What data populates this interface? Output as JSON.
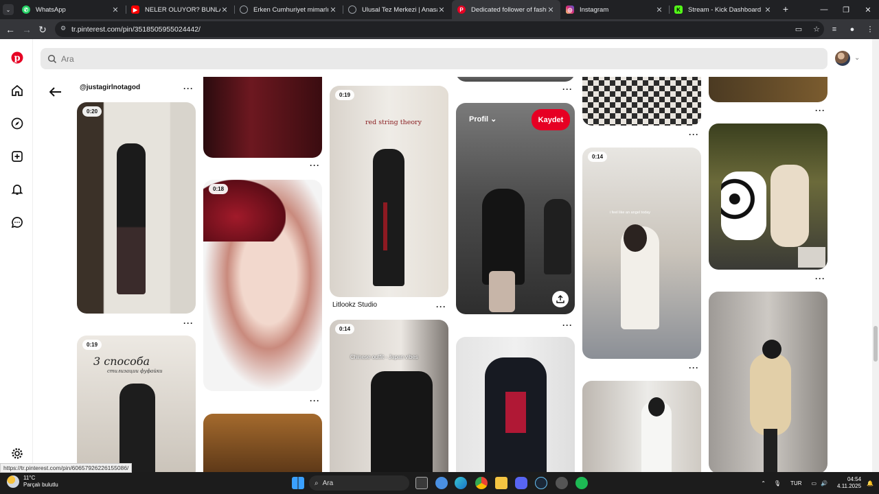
{
  "browser": {
    "tabs": [
      {
        "title": "WhatsApp",
        "icon": "whatsapp-icon",
        "color": "#25d366",
        "active": false
      },
      {
        "title": "NELER OLUYOR? BUNLAR KİM!",
        "icon": "youtube-icon",
        "color": "#ff0000",
        "active": false
      },
      {
        "title": "Erken Cumhuriyet mimarlığı",
        "icon": "web-icon",
        "color": "#9aa0a6",
        "active": false
      },
      {
        "title": "Ulusal Tez Merkezi | Anasayfa",
        "icon": "web-icon",
        "color": "#9aa0a6",
        "active": false
      },
      {
        "title": "Dedicated follower of fashion p",
        "icon": "pinterest-icon",
        "color": "#e60023",
        "active": true
      },
      {
        "title": "Instagram",
        "icon": "instagram-icon",
        "color": "#d62976",
        "active": false
      },
      {
        "title": "Stream - Kick Dashboard",
        "icon": "kick-icon",
        "color": "#53fc18",
        "active": false
      }
    ],
    "url": "tr.pinterest.com/pin/3518505955024442/"
  },
  "search": {
    "placeholder": "Ara"
  },
  "pins": {
    "col1_top_caption": "@justagirlnotagod",
    "col1_a_duration": "0:20",
    "col1_b_duration": "0:19",
    "col1_b_text": "3 способа",
    "col1_b_subtext": "стилизации фуфайки",
    "col2_b_duration": "0:18",
    "col3_a_duration": "0:19",
    "col3_a_text": "red string theory",
    "col3_a_caption": "Litlookz Studio",
    "col3_b_duration": "0:14",
    "col3_b_text": "Chinese outfit - Japan vibes",
    "col5_b_duration": "0:14",
    "col5_b_text": "i feel like an angel today"
  },
  "hover_pin": {
    "profile_label": "Profil",
    "save_label": "Kaydet"
  },
  "status_url": "https://tr.pinterest.com/pin/60657926226155086/",
  "taskbar": {
    "temperature": "11°C",
    "weather": "Parçalı bulutlu",
    "search_label": "Ara",
    "language": "TUR",
    "time": "04:54",
    "date": "4.11.2025"
  },
  "colors": {
    "pinterest_red": "#e60023"
  }
}
